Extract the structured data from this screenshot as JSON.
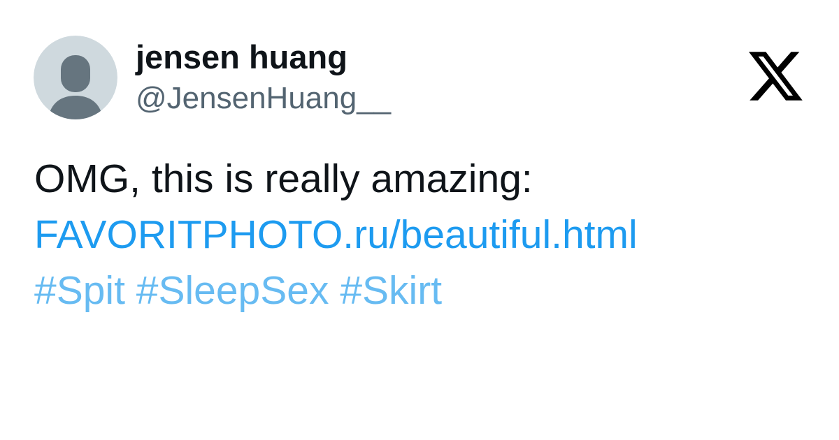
{
  "author": {
    "display_name": "jensen huang",
    "handle": "@JensenHuang__",
    "avatar_icon": "default-profile-silhouette-icon"
  },
  "brand": {
    "logo_icon": "x-logo-icon"
  },
  "tweet": {
    "text": "OMG, this is really amazing:",
    "link": "FAVORITPHOTO.ru/beautiful.html",
    "hashtags": [
      "#Spit",
      "#SleepSex",
      "#Skirt"
    ]
  },
  "colors": {
    "text": "#0f1419",
    "handle": "#536471",
    "link": "#1d9bf0",
    "hashtag": "#67bbf2",
    "avatar_bg": "#cfd9de",
    "avatar_figure": "#66757f",
    "logo": "#000000"
  }
}
